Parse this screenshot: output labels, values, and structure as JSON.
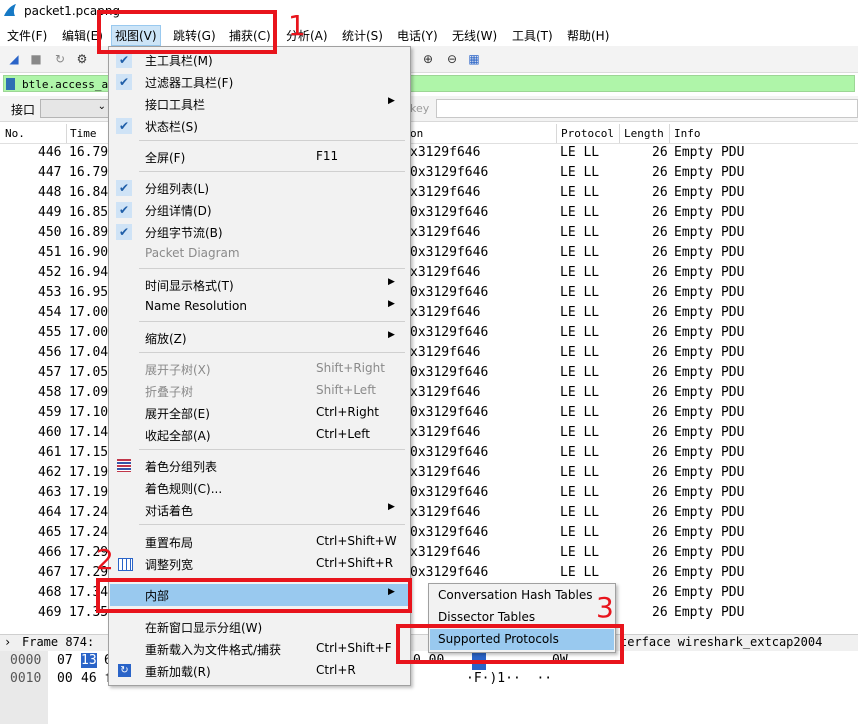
{
  "window": {
    "title": "packet1.pcapng"
  },
  "menubar": {
    "items": [
      {
        "label": "文件(F)"
      },
      {
        "label": "编辑(E)"
      },
      {
        "label": "视图(V)"
      },
      {
        "label": "跳转(G)"
      },
      {
        "label": "捕获(C)"
      },
      {
        "label": "分析(A)"
      },
      {
        "label": "统计(S)"
      },
      {
        "label": "电话(Y)"
      },
      {
        "label": "无线(W)"
      },
      {
        "label": "工具(T)"
      },
      {
        "label": "帮助(H)"
      }
    ]
  },
  "filter": {
    "value": "btle.access_ad"
  },
  "interface_bar": {
    "label": "接口",
    "hint": "key"
  },
  "packet_list": {
    "columns": {
      "no": "No.",
      "time": "Time",
      "dst": "on",
      "protocol": "Protocol",
      "length": "Length",
      "info": "Info"
    },
    "rows": [
      {
        "no": "446",
        "time": "16.79",
        "dst": "x3129f646",
        "proto": "LE LL",
        "len": "26",
        "info": "Empty PDU"
      },
      {
        "no": "447",
        "time": "16.79",
        "dst": "0x3129f646",
        "proto": "LE LL",
        "len": "26",
        "info": "Empty PDU"
      },
      {
        "no": "448",
        "time": "16.84",
        "dst": "x3129f646",
        "proto": "LE LL",
        "len": "26",
        "info": "Empty PDU"
      },
      {
        "no": "449",
        "time": "16.85",
        "dst": "0x3129f646",
        "proto": "LE LL",
        "len": "26",
        "info": "Empty PDU"
      },
      {
        "no": "450",
        "time": "16.89",
        "dst": "x3129f646",
        "proto": "LE LL",
        "len": "26",
        "info": "Empty PDU"
      },
      {
        "no": "451",
        "time": "16.90",
        "dst": "0x3129f646",
        "proto": "LE LL",
        "len": "26",
        "info": "Empty PDU"
      },
      {
        "no": "452",
        "time": "16.94",
        "dst": "x3129f646",
        "proto": "LE LL",
        "len": "26",
        "info": "Empty PDU"
      },
      {
        "no": "453",
        "time": "16.95",
        "dst": "0x3129f646",
        "proto": "LE LL",
        "len": "26",
        "info": "Empty PDU"
      },
      {
        "no": "454",
        "time": "17.00",
        "dst": "x3129f646",
        "proto": "LE LL",
        "len": "26",
        "info": "Empty PDU"
      },
      {
        "no": "455",
        "time": "17.00",
        "dst": "0x3129f646",
        "proto": "LE LL",
        "len": "26",
        "info": "Empty PDU"
      },
      {
        "no": "456",
        "time": "17.04",
        "dst": "x3129f646",
        "proto": "LE LL",
        "len": "26",
        "info": "Empty PDU"
      },
      {
        "no": "457",
        "time": "17.05",
        "dst": "0x3129f646",
        "proto": "LE LL",
        "len": "26",
        "info": "Empty PDU"
      },
      {
        "no": "458",
        "time": "17.09",
        "dst": "x3129f646",
        "proto": "LE LL",
        "len": "26",
        "info": "Empty PDU"
      },
      {
        "no": "459",
        "time": "17.10",
        "dst": "0x3129f646",
        "proto": "LE LL",
        "len": "26",
        "info": "Empty PDU"
      },
      {
        "no": "460",
        "time": "17.14",
        "dst": "x3129f646",
        "proto": "LE LL",
        "len": "26",
        "info": "Empty PDU"
      },
      {
        "no": "461",
        "time": "17.15",
        "dst": "0x3129f646",
        "proto": "LE LL",
        "len": "26",
        "info": "Empty PDU"
      },
      {
        "no": "462",
        "time": "17.19",
        "dst": "x3129f646",
        "proto": "LE LL",
        "len": "26",
        "info": "Empty PDU"
      },
      {
        "no": "463",
        "time": "17.19",
        "dst": "0x3129f646",
        "proto": "LE LL",
        "len": "26",
        "info": "Empty PDU"
      },
      {
        "no": "464",
        "time": "17.24",
        "dst": "x3129f646",
        "proto": "LE LL",
        "len": "26",
        "info": "Empty PDU"
      },
      {
        "no": "465",
        "time": "17.24",
        "dst": "0x3129f646",
        "proto": "LE LL",
        "len": "26",
        "info": "Empty PDU"
      },
      {
        "no": "466",
        "time": "17.29",
        "dst": "x3129f646",
        "proto": "LE LL",
        "len": "26",
        "info": "Empty PDU"
      },
      {
        "no": "467",
        "time": "17.29",
        "dst": "0x3129f646",
        "proto": "LE LL",
        "len": "26",
        "info": "Empty PDU"
      },
      {
        "no": "468",
        "time": "17.34",
        "dst": "",
        "proto": "",
        "len": "26",
        "info": "Empty PDU"
      },
      {
        "no": "469",
        "time": "17.35",
        "dst": "",
        "proto": "",
        "len": "26",
        "info": "Empty PDU"
      }
    ]
  },
  "details": {
    "left": "Frame 874:",
    "tail": "terface wireshark_extcap2004"
  },
  "bytes": {
    "rows": [
      {
        "offset": "0000",
        "first": "07",
        "sel": "13",
        "after": "6",
        "mid": "0 00",
        "right": "0W"
      },
      {
        "offset": "0010",
        "first": "00",
        "sel": "",
        "after": "46 f",
        "mid": "",
        "right": "·F·)1··  ··"
      }
    ]
  },
  "view_menu": {
    "items": [
      {
        "label": "主工具栏(M)",
        "checked": true
      },
      {
        "label": "过滤器工具栏(F)",
        "checked": true
      },
      {
        "label": "接口工具栏",
        "submenu": true
      },
      {
        "label": "状态栏(S)",
        "checked": true
      },
      {
        "label": "全屏(F)",
        "shortcut": "F11"
      },
      {
        "label": "分组列表(L)",
        "checked": true
      },
      {
        "label": "分组详情(D)",
        "checked": true
      },
      {
        "label": "分组字节流(B)",
        "checked": true
      },
      {
        "label": "Packet Diagram",
        "disabled": true
      },
      {
        "label": "时间显示格式(T)",
        "submenu": true
      },
      {
        "label": "Name Resolution",
        "submenu": true
      },
      {
        "label": "缩放(Z)",
        "submenu": true
      },
      {
        "label": "展开子树(X)",
        "shortcut": "Shift+Right",
        "disabled": true
      },
      {
        "label": "折叠子树",
        "shortcut": "Shift+Left",
        "disabled": true
      },
      {
        "label": "展开全部(E)",
        "shortcut": "Ctrl+Right"
      },
      {
        "label": "收起全部(A)",
        "shortcut": "Ctrl+Left"
      },
      {
        "label": "着色分组列表",
        "icon": "color-list-icon"
      },
      {
        "label": "着色规则(C)..."
      },
      {
        "label": "对话着色",
        "submenu": true
      },
      {
        "label": "重置布局",
        "shortcut": "Ctrl+Shift+W"
      },
      {
        "label": "调整列宽",
        "shortcut": "Ctrl+Shift+R",
        "icon": "resize-columns-icon"
      },
      {
        "label": "内部",
        "submenu": true,
        "highlighted": true
      },
      {
        "label": "在新窗口显示分组(W)"
      },
      {
        "label": "重新载入为文件格式/捕获",
        "shortcut": "Ctrl+Shift+F"
      },
      {
        "label": "重新加载(R)",
        "shortcut": "Ctrl+R",
        "icon": "reload-icon"
      }
    ]
  },
  "internals_submenu": {
    "items": [
      {
        "label": "Conversation Hash Tables"
      },
      {
        "label": "Dissector Tables"
      },
      {
        "label": "Supported Protocols",
        "highlighted": true
      }
    ]
  },
  "annotations": {
    "step1": "1",
    "step2": "2",
    "step3": "3",
    "color": "#e8141c"
  },
  "colors": {
    "filter_bg": "#aff5a9",
    "menu_highlight": "#99c9ef",
    "selection": "#2a64c8"
  }
}
